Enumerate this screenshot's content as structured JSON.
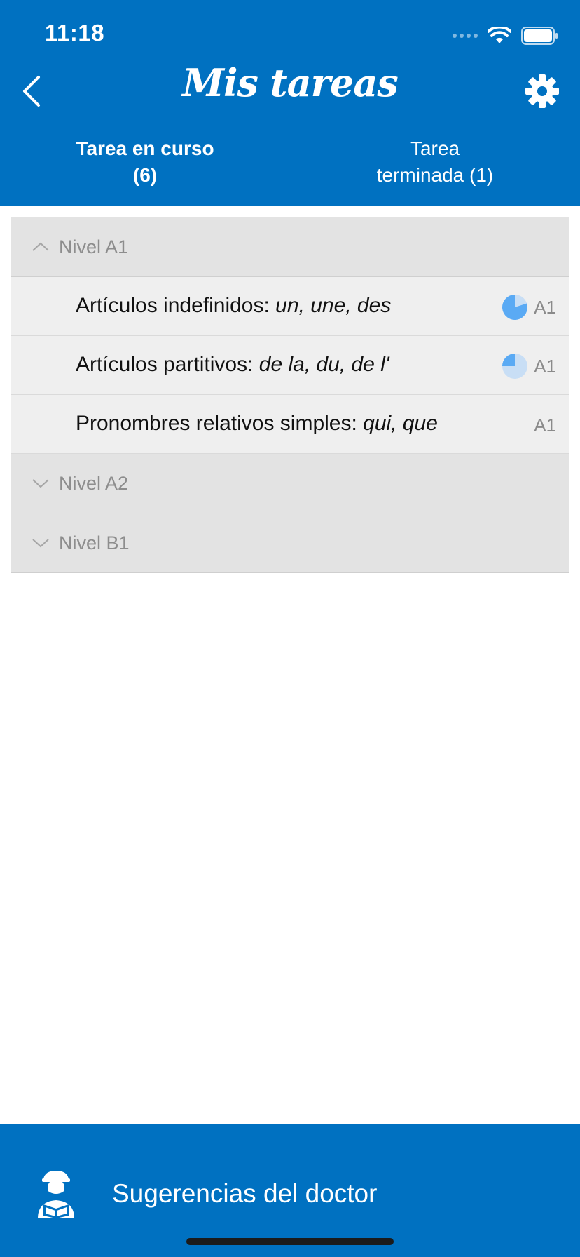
{
  "status": {
    "time": "11:18"
  },
  "header": {
    "title": "Mis tareas"
  },
  "tabs": [
    {
      "line1": "Tarea en curso",
      "line2": "(6)",
      "active": true
    },
    {
      "line1": "Tarea",
      "line2": "terminada (1)",
      "active": false
    }
  ],
  "groups": [
    {
      "label": "Nivel A1",
      "expanded": true,
      "items": [
        {
          "prefix": "Artículos indefinidos: ",
          "emphasis": "un, une, des",
          "level": "A1",
          "progress": 0.8
        },
        {
          "prefix": "Artículos partitivos: ",
          "emphasis": "de la, du, de l'",
          "level": "A1",
          "progress": 0.25
        },
        {
          "prefix": "Pronombres relativos simples: ",
          "emphasis": "qui, que",
          "level": "A1",
          "progress": null
        }
      ]
    },
    {
      "label": "Nivel A2",
      "expanded": false
    },
    {
      "label": "Nivel B1",
      "expanded": false
    }
  ],
  "footer": {
    "label": "Sugerencias del doctor"
  },
  "colors": {
    "brand": "#0071c1",
    "pie_fill": "#5aaaf4",
    "pie_track": "#c8def5"
  },
  "icons": [
    "back-icon",
    "gear-icon",
    "chevron-up-icon",
    "chevron-down-icon",
    "progress-pie-icon",
    "doctor-icon",
    "wifi-icon",
    "battery-icon",
    "signal-icon"
  ]
}
